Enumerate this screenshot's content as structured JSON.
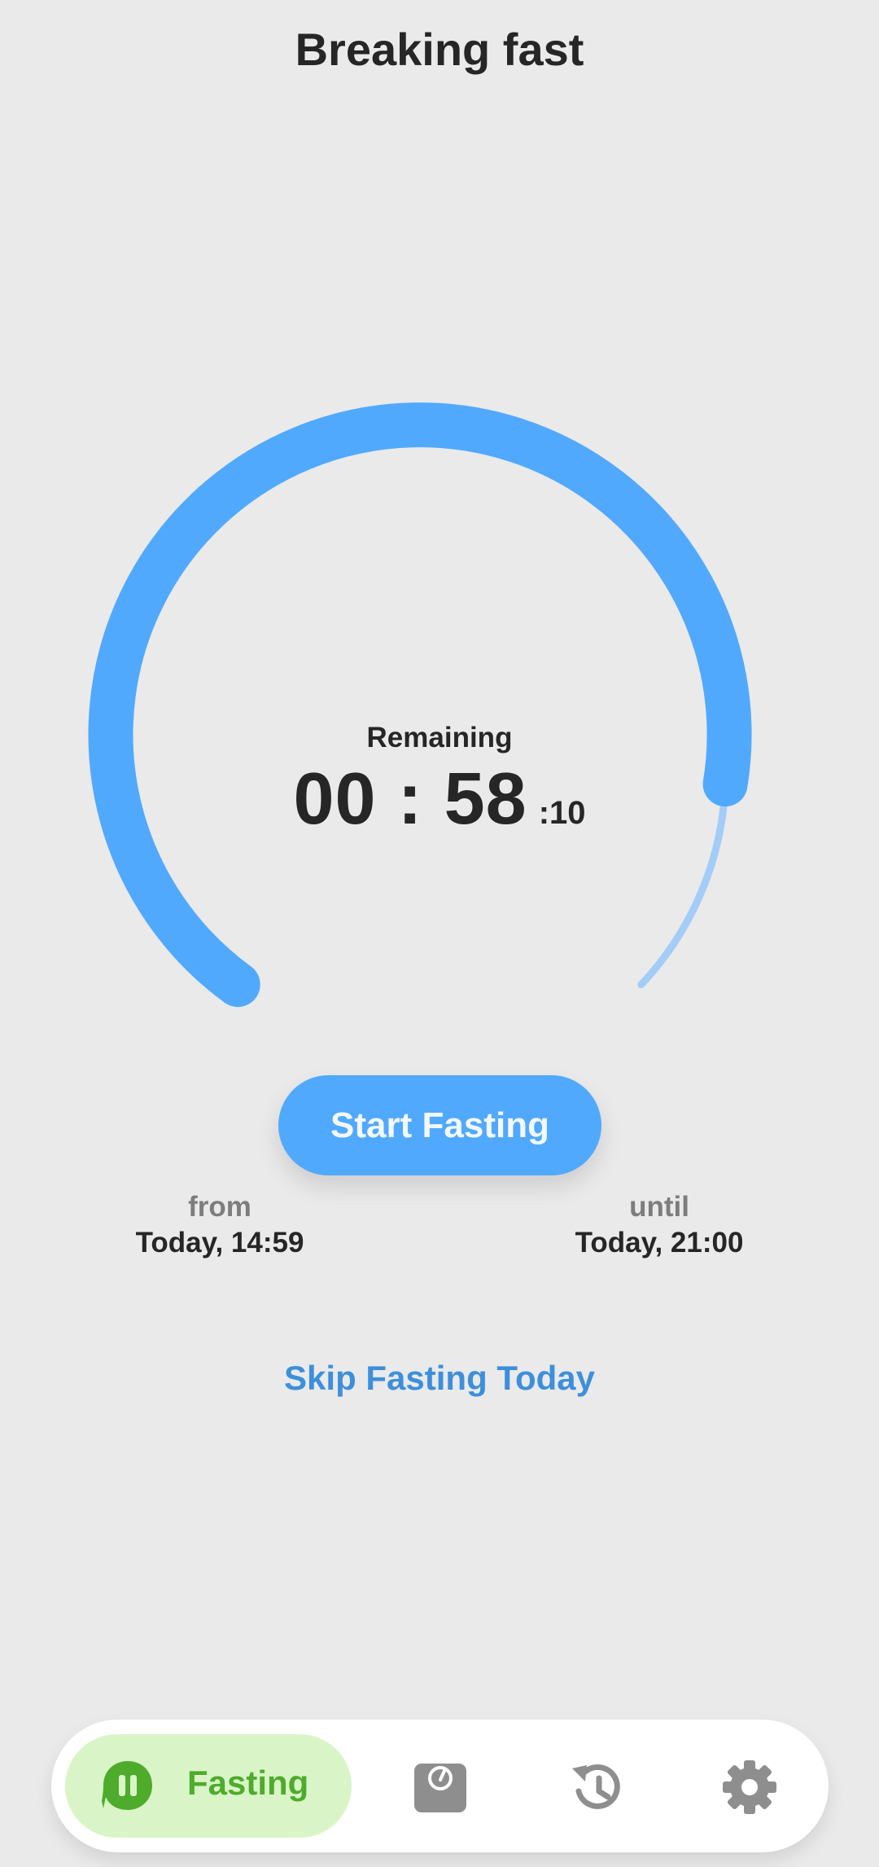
{
  "header": {
    "title": "Breaking fast"
  },
  "timer": {
    "label": "Remaining",
    "hours_minutes": "00 : 58",
    "seconds": ":10",
    "progress_fraction": 0.93,
    "colors": {
      "progress": "#51a9fd",
      "track": "#a3cdf7"
    }
  },
  "actions": {
    "start_label": "Start Fasting",
    "skip_label": "Skip Fasting Today"
  },
  "window": {
    "from_label": "from",
    "from_value": "Today, 14:59",
    "until_label": "until",
    "until_value": "Today, 21:00"
  },
  "nav": {
    "items": [
      {
        "label": "Fasting",
        "icon": "fasting-pause-icon",
        "active": true
      },
      {
        "label": "",
        "icon": "weight-scale-icon",
        "active": false
      },
      {
        "label": "",
        "icon": "history-icon",
        "active": false
      },
      {
        "label": "",
        "icon": "gear-icon",
        "active": false
      }
    ],
    "colors": {
      "active_bg": "#d9f5c8",
      "active_fg": "#4fab2b",
      "inactive_fg": "#8e8e8e"
    }
  }
}
